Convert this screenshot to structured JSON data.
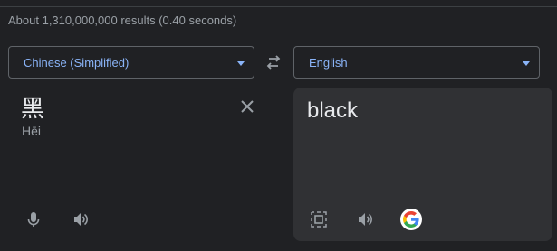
{
  "results_text": "About 1,310,000,000 results (0.40 seconds)",
  "source_language": "Chinese (Simplified)",
  "target_language": "English",
  "source_text": "黑",
  "source_pinyin": "Hēi",
  "translation": "black",
  "icons": {
    "swap": "swap-arrows-icon",
    "clear": "close-icon",
    "mic": "microphone-icon",
    "speaker": "speaker-icon",
    "copy": "select-frame-icon",
    "google": "google-logo-icon"
  },
  "colors": {
    "background": "#202124",
    "panel": "#303134",
    "accent": "#8ab4f8",
    "text": "#e8eaed",
    "muted": "#9aa0a6"
  }
}
